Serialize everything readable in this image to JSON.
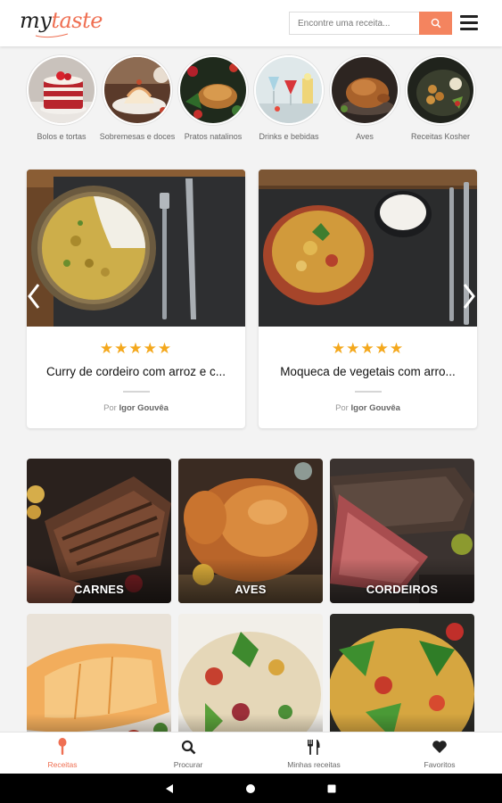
{
  "header": {
    "logo_my": "my",
    "logo_taste": "taste",
    "search_placeholder": "Encontre uma receita...",
    "icons": {
      "search": "search-icon",
      "menu": "hamburger-menu-icon"
    },
    "accent_color": "#f4845f"
  },
  "categories": [
    {
      "label": "Bolos e tortas"
    },
    {
      "label": "Sobremesas e doces"
    },
    {
      "label": "Pratos natalinos"
    },
    {
      "label": "Drinks e bebidas"
    },
    {
      "label": "Aves"
    },
    {
      "label": "Receitas Kosher"
    }
  ],
  "recipes": [
    {
      "rating": "★★★★★",
      "title": "Curry de cordeiro com arroz e c...",
      "by": "Por",
      "author": "Igor Gouvêa"
    },
    {
      "rating": "★★★★★",
      "title": "Moqueca de vegetais com arro...",
      "by": "Por",
      "author": "Igor Gouvêa"
    }
  ],
  "tiles": [
    {
      "label": "CARNES"
    },
    {
      "label": "AVES"
    },
    {
      "label": "CORDEIROS"
    },
    {
      "label": ""
    },
    {
      "label": ""
    },
    {
      "label": ""
    }
  ],
  "bottom_nav": [
    {
      "label": "Receitas",
      "icon": "spoon-icon",
      "active": true
    },
    {
      "label": "Procurar",
      "icon": "search-icon",
      "active": false
    },
    {
      "label": "Minhas receitas",
      "icon": "fork-knife-icon",
      "active": false
    },
    {
      "label": "Favoritos",
      "icon": "heart-icon",
      "active": false
    }
  ],
  "system_bar": {
    "icons": [
      "back-icon",
      "home-icon",
      "recents-icon"
    ]
  }
}
